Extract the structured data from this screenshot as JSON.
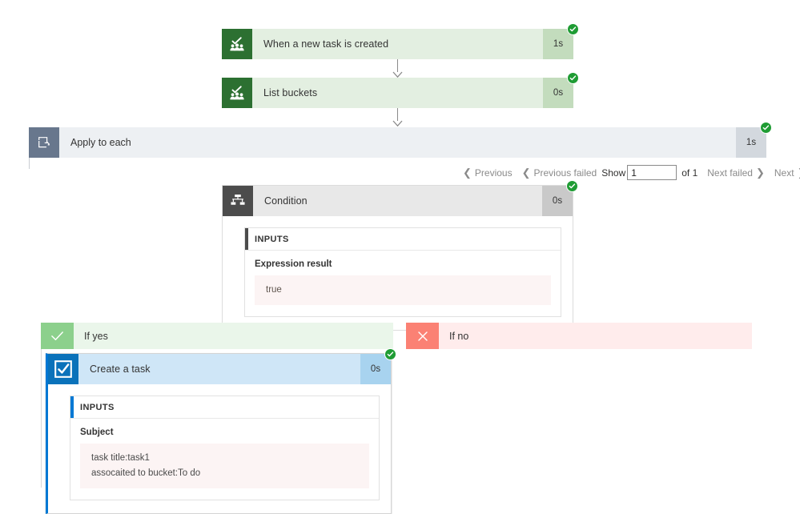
{
  "flow": {
    "trigger": {
      "name": "When a new task is created",
      "duration": "1s",
      "status": "succeeded",
      "icon": "planner-icon"
    },
    "list_buckets": {
      "name": "List buckets",
      "duration": "0s",
      "status": "succeeded",
      "icon": "planner-icon"
    },
    "apply_to_each": {
      "name": "Apply to each",
      "duration": "1s",
      "status": "succeeded",
      "icon": "loop-icon"
    },
    "pager": {
      "previous": "Previous",
      "previous_failed": "Previous failed",
      "show_label": "Show",
      "page_value": "1",
      "of_label": "of 1",
      "next_failed": "Next failed",
      "next": "Next"
    },
    "condition": {
      "name": "Condition",
      "duration": "0s",
      "status": "succeeded",
      "icon": "condition-icon",
      "inputs_header": "INPUTS",
      "field_label": "Expression result",
      "field_value": "true"
    },
    "if_yes": {
      "label": "If yes",
      "icon": "check-icon"
    },
    "if_no": {
      "label": "If no",
      "icon": "cross-icon"
    },
    "create_task": {
      "name": "Create a task",
      "duration": "0s",
      "status": "succeeded",
      "icon": "checkbox-icon",
      "inputs_header": "INPUTS",
      "field_label": "Subject",
      "field_line_1": "task title:task1",
      "field_line_2": "assocaited to bucket:To do"
    }
  },
  "colors": {
    "planner_green": "#2c7031",
    "planner_green_bg": "#e3efe1",
    "condition_gray": "#4c4c4c",
    "task_blue": "#0078d4",
    "success_green": "#1f9c34",
    "branch_yes_green": "#8cd08c",
    "branch_no_red": "#fb8174",
    "scope_slate": "#68778d"
  }
}
